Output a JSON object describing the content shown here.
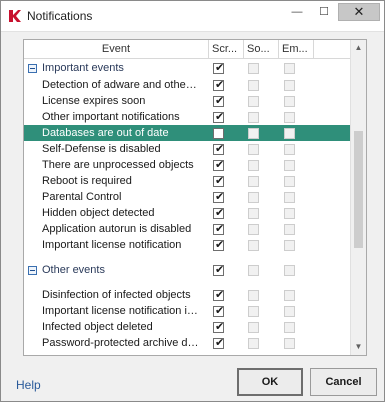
{
  "window": {
    "title": "Notifications",
    "controls": {
      "minimize": "—",
      "maximize": "☐",
      "close": "✕"
    }
  },
  "table": {
    "columns": [
      {
        "label": "Event"
      },
      {
        "label": "Scr..."
      },
      {
        "label": "So..."
      },
      {
        "label": "Em..."
      }
    ],
    "rows": [
      {
        "type": "group",
        "label": "Important events",
        "checked": true
      },
      {
        "type": "item",
        "label": "Detection of adware and other s...",
        "checked": true
      },
      {
        "type": "item",
        "label": "License expires soon",
        "checked": true
      },
      {
        "type": "item",
        "label": "Other important notifications",
        "checked": true
      },
      {
        "type": "item",
        "label": "Databases are out of date",
        "checked": false,
        "selected": true
      },
      {
        "type": "item",
        "label": "Self-Defense is disabled",
        "checked": true
      },
      {
        "type": "item",
        "label": "There are unprocessed objects",
        "checked": true
      },
      {
        "type": "item",
        "label": "Reboot is required",
        "checked": true
      },
      {
        "type": "item",
        "label": "Parental Control",
        "checked": true
      },
      {
        "type": "item",
        "label": "Hidden object detected",
        "checked": true
      },
      {
        "type": "item",
        "label": "Application autorun is disabled",
        "checked": true
      },
      {
        "type": "item",
        "label": "Important license notification",
        "checked": true
      },
      {
        "type": "spacer"
      },
      {
        "type": "group",
        "label": "Other events",
        "checked": true
      },
      {
        "type": "spacer"
      },
      {
        "type": "item",
        "label": "Disinfection of infected objects",
        "checked": true
      },
      {
        "type": "item",
        "label": "Important license notification is ...",
        "checked": true
      },
      {
        "type": "item",
        "label": "Infected object deleted",
        "checked": true
      },
      {
        "type": "item",
        "label": "Password-protected archive det...",
        "checked": true
      }
    ]
  },
  "scrollbar": {
    "position": 0.45
  },
  "footer": {
    "help_label": "Help",
    "ok_label": "OK",
    "cancel_label": "Cancel"
  },
  "colors": {
    "selection": "#2f8f7a",
    "help_link": "#2a5a9a"
  }
}
